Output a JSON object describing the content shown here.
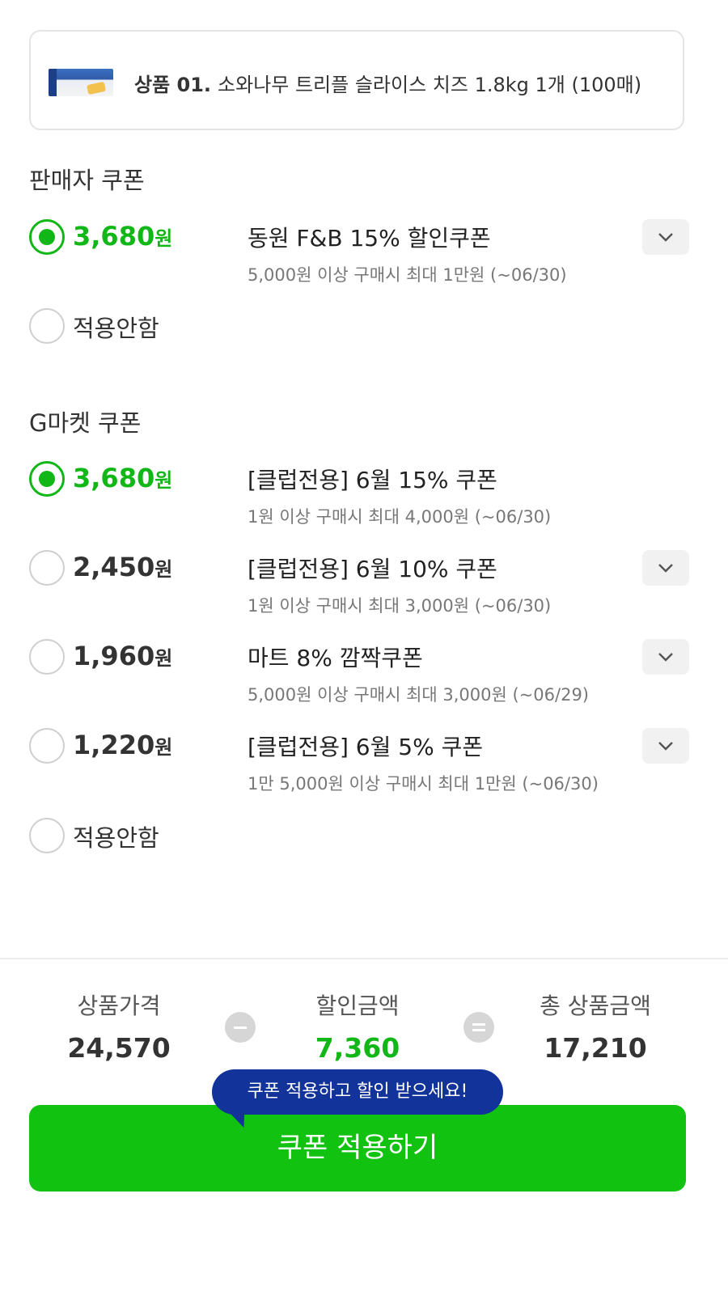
{
  "product": {
    "label": "상품 01.",
    "name": "소와나무 트리플 슬라이스 치즈 1.8kg 1개 (100매)",
    "thumbnail_icon": "cheese-package-thumbnail"
  },
  "seller_coupons": {
    "title": "판매자 쿠폰",
    "items": [
      {
        "amount": "3,680",
        "unit": "원",
        "name": "동원 F&B 15% 할인쿠폰",
        "condition": "5,000원 이상 구매시 최대 1만원 (~06/30)",
        "selected": true,
        "expandable": true
      }
    ],
    "none_label": "적용안함"
  },
  "gmarket_coupons": {
    "title": "G마켓 쿠폰",
    "items": [
      {
        "amount": "3,680",
        "unit": "원",
        "name": "[클럽전용] 6월 15% 쿠폰",
        "condition": "1원 이상 구매시 최대 4,000원 (~06/30)",
        "selected": true,
        "expandable": false
      },
      {
        "amount": "2,450",
        "unit": "원",
        "name": "[클럽전용] 6월 10% 쿠폰",
        "condition": "1원 이상 구매시 최대 3,000원 (~06/30)",
        "selected": false,
        "expandable": true
      },
      {
        "amount": "1,960",
        "unit": "원",
        "name": "마트 8% 깜짝쿠폰",
        "condition": "5,000원 이상 구매시 최대 3,000원 (~06/29)",
        "selected": false,
        "expandable": true
      },
      {
        "amount": "1,220",
        "unit": "원",
        "name": "[클럽전용] 6월 5% 쿠폰",
        "condition": "1만 5,000원 이상 구매시 최대 1만원 (~06/30)",
        "selected": false,
        "expandable": true
      }
    ],
    "none_label": "적용안함"
  },
  "summary": {
    "price_label": "상품가격",
    "price_value": "24,570",
    "discount_label": "할인금액",
    "discount_value": "7,360",
    "total_label": "총 상품금액",
    "total_value": "17,210"
  },
  "tooltip": "쿠폰 적용하고 할인 받으세요!",
  "apply_button": "쿠폰 적용하기",
  "colors": {
    "accent_green": "#11b617",
    "button_green": "#11c211",
    "tooltip_navy": "#12339a"
  }
}
